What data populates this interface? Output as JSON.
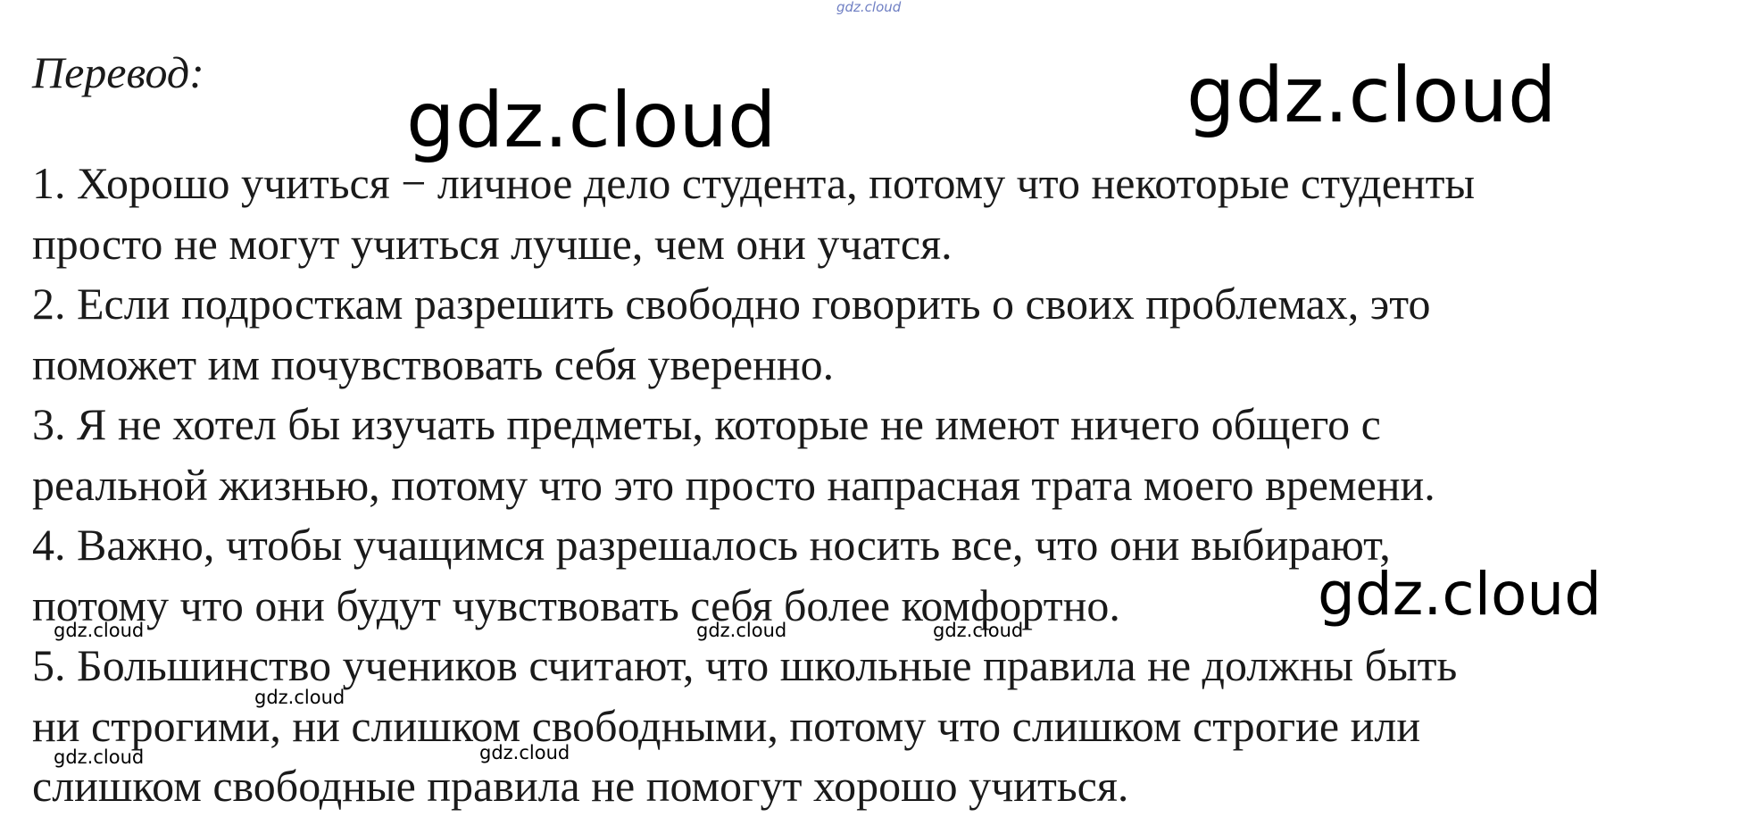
{
  "heading": "Перевод:",
  "lines": [
    "1. Хорошо учиться − личное дело студента, потому что некоторые студенты",
    "просто не могут учиться лучше, чем они учатся.",
    "2. Если подросткам разрешить свободно говорить о своих проблемах, это",
    "поможет им почувствовать себя уверенно.",
    "3. Я не хотел бы изучать предметы, которые не имеют ничего общего с",
    "реальной жизнью, потому что это просто напрасная трата моего времени.",
    "4. Важно, чтобы учащимся разрешалось носить все, что они выбирают,",
    "потому что они будут чувствовать себя более комфортно.",
    "5. Большинство учеников считают, что школьные правила не должны быть",
    "ни строгими, ни слишком свободными, потому что слишком строгие или",
    "слишком свободные правила не помогут хорошо учиться."
  ],
  "watermarks": {
    "top": "gdz.cloud",
    "big_left": "gdz.cloud",
    "big_right": "gdz.cloud",
    "mid_right": "gdz.cloud",
    "small_1": "gdz.cloud",
    "small_2": "gdz.cloud",
    "small_3": "gdz.cloud",
    "small_4": "gdz.cloud",
    "small_5": "gdz.cloud",
    "small_6": "gdz.cloud"
  }
}
